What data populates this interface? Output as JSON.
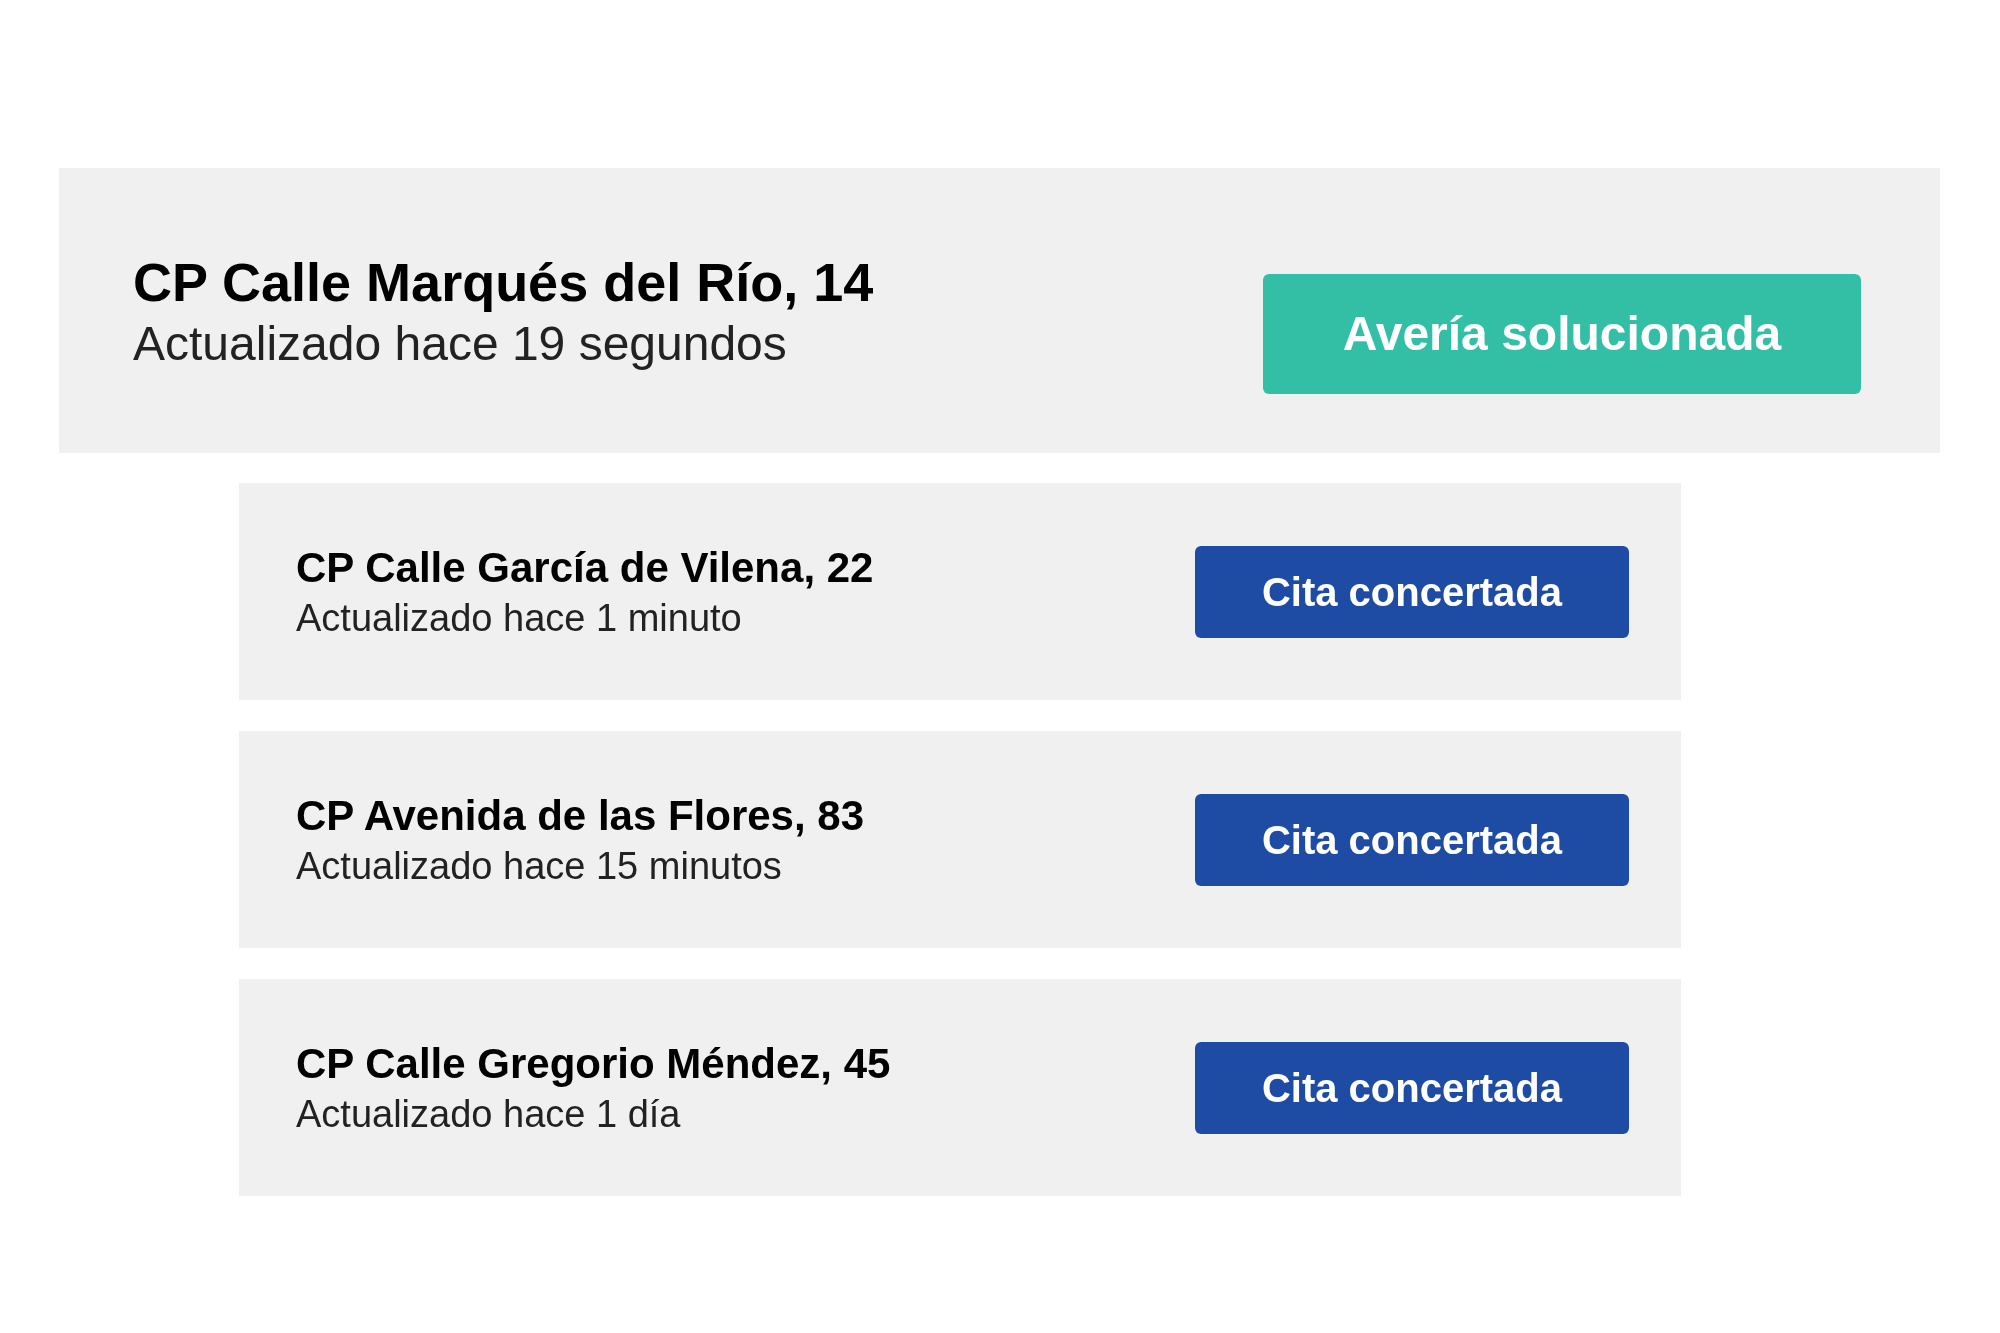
{
  "featured": {
    "title": "CP Calle Marqués del Río, 14",
    "updated": "Actualizado hace 19 segundos",
    "status": {
      "label": "Avería solucionada",
      "kind": "solved"
    }
  },
  "items": [
    {
      "title": "CP Calle García de Vilena, 22",
      "updated": "Actualizado hace 1 minuto",
      "status": {
        "label": "Cita concertada",
        "kind": "scheduled"
      }
    },
    {
      "title": "CP Avenida de las Flores, 83",
      "updated": "Actualizado hace 15 minutos",
      "status": {
        "label": "Cita concertada",
        "kind": "scheduled"
      }
    },
    {
      "title": "CP Calle Gregorio Méndez, 45",
      "updated": "Actualizado hace 1 día",
      "status": {
        "label": "Cita concertada",
        "kind": "scheduled"
      }
    }
  ]
}
